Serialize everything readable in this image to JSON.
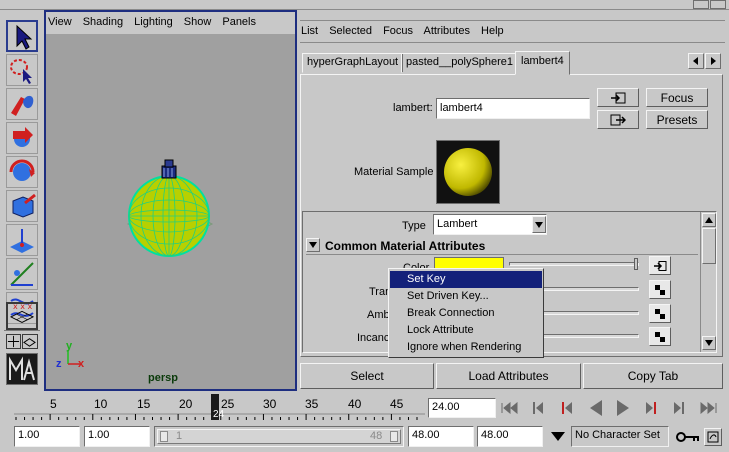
{
  "viewport": {
    "menu": [
      "View",
      "Shading",
      "Lighting",
      "Show",
      "Panels"
    ],
    "camera_label": "persp",
    "axis_y": "y",
    "axis_z": "z",
    "axis_x": "x"
  },
  "editor": {
    "menu": [
      "List",
      "Selected",
      "Focus",
      "Attributes",
      "Help"
    ],
    "tabs": [
      "hyperGraphLayout",
      "pasted__polySphere1",
      "lambert4"
    ],
    "node_label": "lambert:",
    "node_value": "lambert4",
    "focus_label": "Focus",
    "presets_label": "Presets",
    "material_sample_label": "Material Sample",
    "type_label": "Type",
    "type_value": "Lambert",
    "section_title": "Common Material Attributes",
    "attrs": [
      "Color",
      "Tran",
      "Amb",
      "Incanc"
    ],
    "color_value": "#ffff00",
    "bottom_buttons": [
      "Select",
      "Load Attributes",
      "Copy Tab"
    ]
  },
  "context_menu": {
    "items": [
      "Set Key",
      "Set Driven Key...",
      "Break Connection",
      "Lock Attribute",
      "Ignore when Rendering"
    ]
  },
  "timeline": {
    "ticks": [
      "5",
      "10",
      "15",
      "20",
      "25",
      "30",
      "35",
      "40",
      "45"
    ],
    "current_frame": "24",
    "current_time": "24.00"
  },
  "range": {
    "start": "1.00",
    "playback_start": "1.00",
    "slider_start": "1",
    "slider_end": "48",
    "playback_end": "48.00",
    "end": "48.00",
    "character_set": "No Character Set"
  }
}
